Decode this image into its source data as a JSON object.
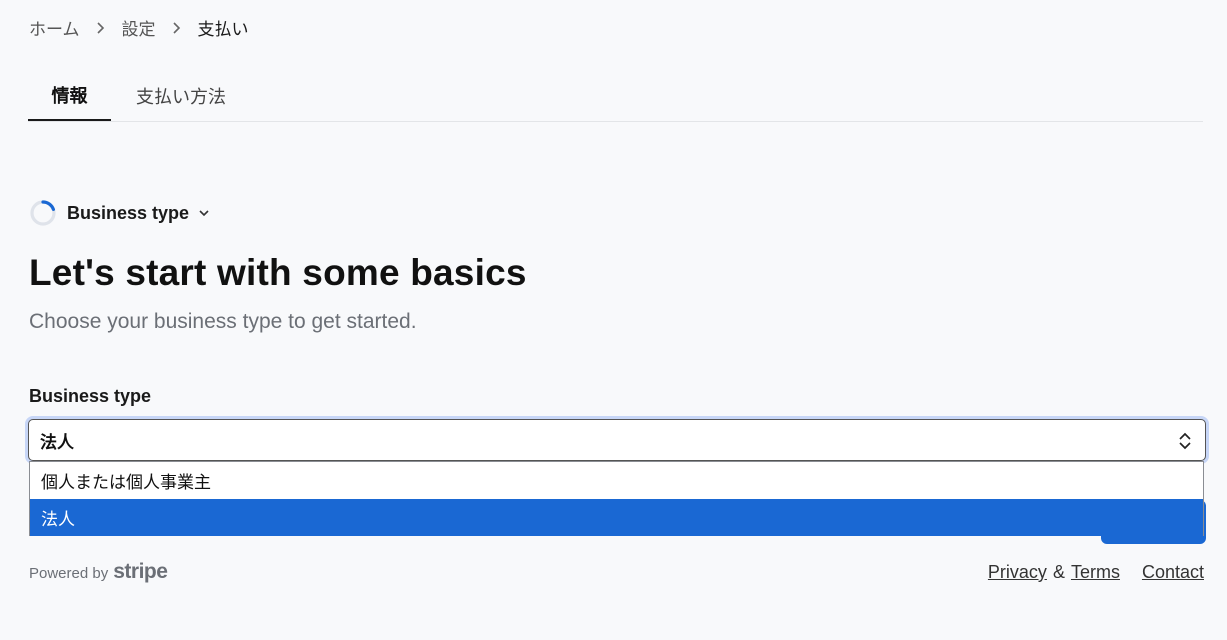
{
  "breadcrumb": {
    "items": [
      "ホーム",
      "設定",
      "支払い"
    ]
  },
  "tabs": [
    {
      "label": "情報",
      "active": true
    },
    {
      "label": "支払い方法",
      "active": false
    }
  ],
  "step": {
    "label": "Business type",
    "icon": "progress-spinner-icon"
  },
  "main": {
    "heading": "Let's start with some basics",
    "subtitle": "Choose your business type to get started."
  },
  "field": {
    "label": "Business type",
    "value": "法人",
    "options": [
      {
        "label": "個人または個人事業主",
        "selected": false
      },
      {
        "label": "法人",
        "selected": true
      }
    ]
  },
  "footer": {
    "powered_by": "Powered by",
    "brand": "stripe",
    "privacy": "Privacy",
    "amp": "&",
    "terms": "Terms",
    "contact": "Contact"
  },
  "colors": {
    "accent": "#1a68d3",
    "focus_ring": "#c7d6f7",
    "background": "#f8f9fb"
  }
}
